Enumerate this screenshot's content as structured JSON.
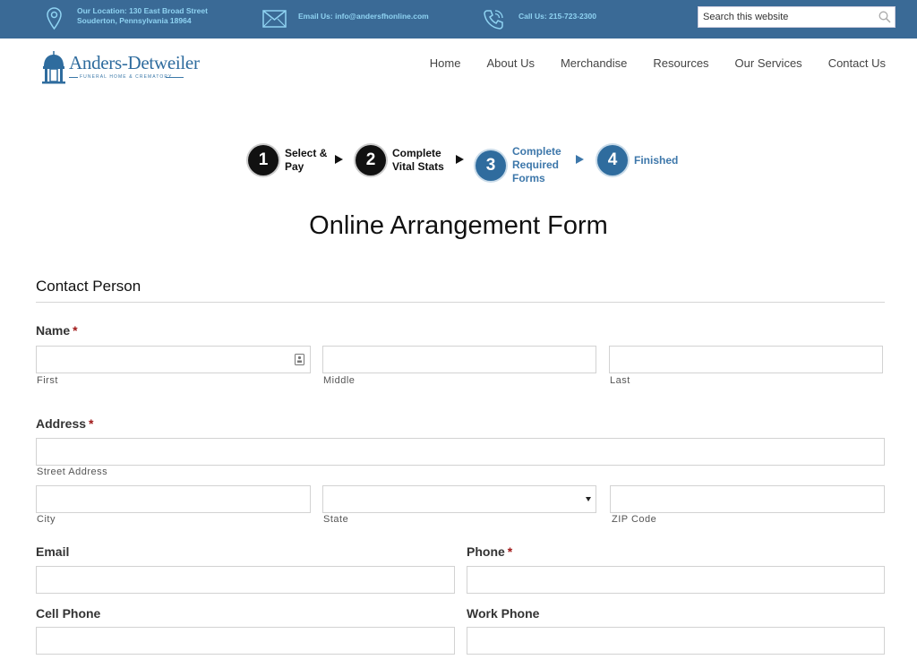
{
  "topbar": {
    "location_line1": "Our Location: 130 East Broad Street",
    "location_line2": "Souderton, Pennsylvania 18964",
    "email": "Email Us: info@andersfhonline.com",
    "phone": "Call Us: 215-723-2300",
    "search_placeholder": "Search this website",
    "text_color": "#8fd3f2",
    "bg_color": "#3a6a96"
  },
  "logo": {
    "name": "Anders-Detweiler",
    "tagline": "FUNERAL HOME & CREMATORY"
  },
  "nav": {
    "items": [
      "Home",
      "About Us",
      "Merchandise",
      "Resources",
      "Our Services",
      "Contact Us"
    ]
  },
  "steps": [
    {
      "number": "1",
      "line1": "Select &",
      "line2": "Pay",
      "line3": "",
      "state": "done"
    },
    {
      "number": "2",
      "line1": "Complete",
      "line2": "Vital Stats",
      "line3": "",
      "state": "done"
    },
    {
      "number": "3",
      "line1": "Complete",
      "line2": "Required",
      "line3": "Forms",
      "state": "todo"
    },
    {
      "number": "4",
      "line1": "Finished",
      "line2": "",
      "line3": "",
      "state": "todo"
    }
  ],
  "form": {
    "title": "Online Arrangement Form",
    "section": "Contact Person",
    "required_mark": "*",
    "name": {
      "label": "Name",
      "first": "First",
      "middle": "Middle",
      "last": "Last"
    },
    "address": {
      "label": "Address",
      "street": "Street Address",
      "city": "City",
      "state": "State",
      "zip": "ZIP Code"
    },
    "email_label": "Email",
    "phone_label": "Phone",
    "cell_label": "Cell Phone",
    "work_label": "Work Phone"
  }
}
